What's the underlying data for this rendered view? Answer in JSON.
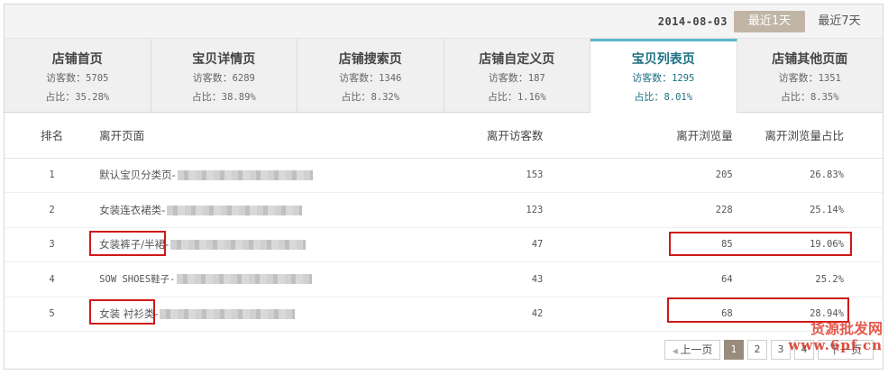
{
  "toolbar": {
    "date": "2014-08-03",
    "btn_1day": "最近1天",
    "btn_7day": "最近7天"
  },
  "tabs": [
    {
      "title": "店铺首页",
      "visitors_label": "访客数：",
      "visitors": "5705",
      "ratio_label": "占比：",
      "ratio": "35.28%"
    },
    {
      "title": "宝贝详情页",
      "visitors_label": "访客数：",
      "visitors": "6289",
      "ratio_label": "占比：",
      "ratio": "38.89%"
    },
    {
      "title": "店铺搜索页",
      "visitors_label": "访客数：",
      "visitors": "1346",
      "ratio_label": "占比：",
      "ratio": "8.32%"
    },
    {
      "title": "店铺自定义页",
      "visitors_label": "访客数：",
      "visitors": "187",
      "ratio_label": "占比：",
      "ratio": "1.16%"
    },
    {
      "title": "宝贝列表页",
      "visitors_label": "访客数：",
      "visitors": "1295",
      "ratio_label": "占比：",
      "ratio": "8.01%"
    },
    {
      "title": "店铺其他页面",
      "visitors_label": "访客数：",
      "visitors": "1351",
      "ratio_label": "占比：",
      "ratio": "8.35%"
    }
  ],
  "active_tab_index": 4,
  "accent_color": "#5ab8c8",
  "table": {
    "headers": {
      "rank": "排名",
      "page": "离开页面",
      "visitors": "离开访客数",
      "pv": "离开浏览量",
      "pv_ratio": "离开浏览量占比"
    },
    "rows": [
      {
        "rank": "1",
        "page": "默认宝贝分类页-",
        "visitors": "153",
        "pv": "205",
        "pv_ratio": "26.83%"
      },
      {
        "rank": "2",
        "page": "女装连衣裙类-",
        "visitors": "123",
        "pv": "228",
        "pv_ratio": "25.14%"
      },
      {
        "rank": "3",
        "page": "女装裤子/半裙-",
        "visitors": "47",
        "pv": "85",
        "pv_ratio": "19.06%"
      },
      {
        "rank": "4",
        "page": "SOW SHOES鞋子-",
        "visitors": "43",
        "pv": "64",
        "pv_ratio": "25.2%"
      },
      {
        "rank": "5",
        "page": "女装 衬衫类-",
        "visitors": "42",
        "pv": "68",
        "pv_ratio": "28.94%"
      }
    ]
  },
  "pager": {
    "prev": "上一页",
    "pages": [
      "1",
      "2",
      "3",
      "4"
    ],
    "current": "1",
    "next": "下一页"
  },
  "watermark": {
    "line1": "货源批发网",
    "line2": "www.6pf.cn"
  },
  "highlight_color": "#d01818"
}
